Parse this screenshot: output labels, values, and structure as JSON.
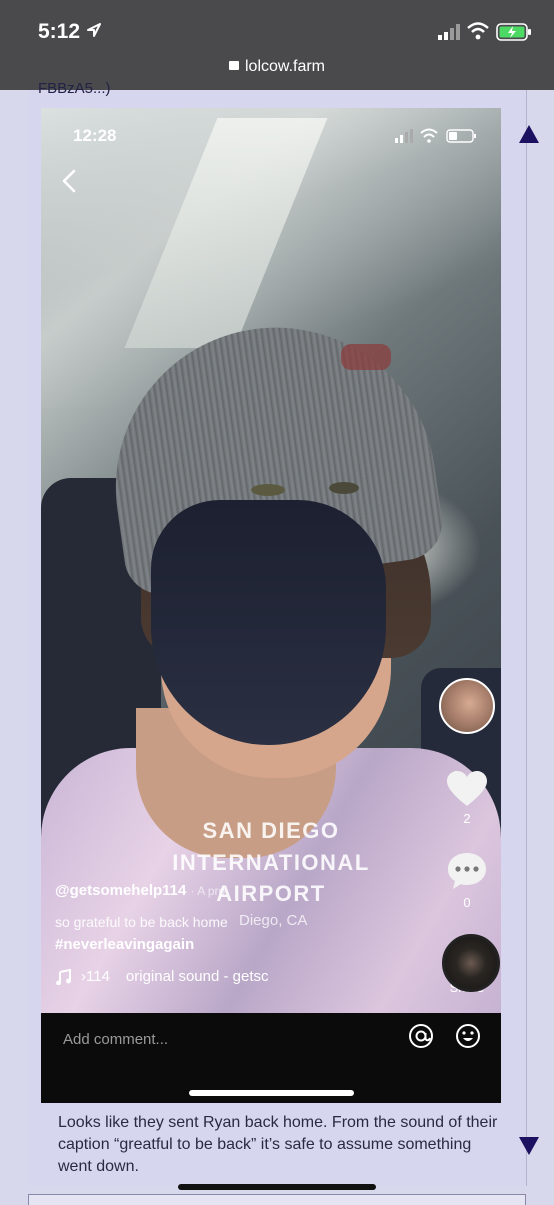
{
  "status_bar": {
    "time": "5:12",
    "url": "lolcow.farm"
  },
  "post": {
    "cut_text": "FBBzA5...)",
    "body_text": "Looks like they sent Ryan back home. From the sound of their caption “greatful to be back” it’s safe to assume something went down."
  },
  "embedded": {
    "status_time": "12:28",
    "location_line1": "SAN DIEGO",
    "location_line2": "INTERNATIONAL",
    "location_line3": "AIRPORT",
    "location_sub": "Diego, CA",
    "username": "@getsomehelp114",
    "age": "· A pro",
    "caption": "so grateful to be back home",
    "hashtag": "#neverleavingagain",
    "music_prefix": "›114",
    "sound": "original sound - getsc",
    "like_count": "2",
    "comment_count": "0",
    "share_label": "Share",
    "comment_placeholder": "Add comment..."
  }
}
